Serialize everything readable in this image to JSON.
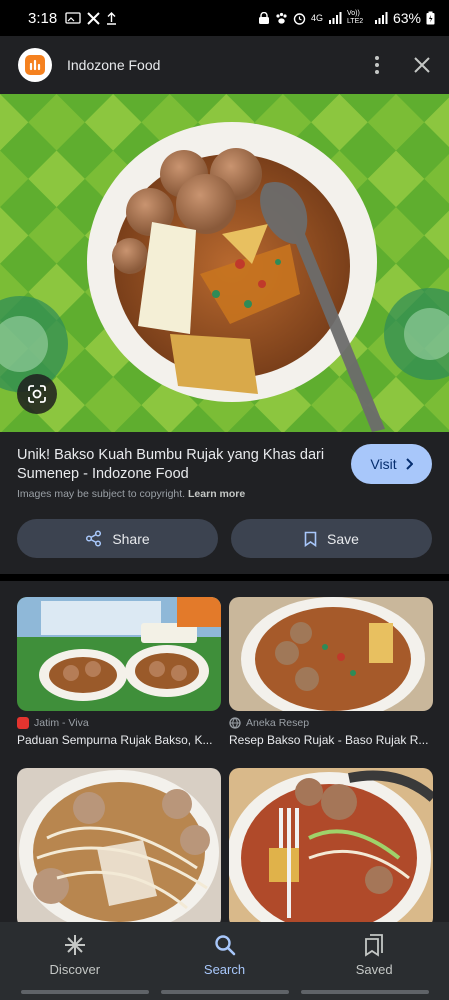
{
  "status_bar": {
    "time": "3:18",
    "network_label": "4G",
    "volte_label": "Vo)) LTE2",
    "battery": "63%"
  },
  "source": {
    "name": "Indozone Food",
    "logo_color": "#f5811f"
  },
  "result": {
    "title": "Unik! Bakso Kuah Bumbu Rujak yang Khas dari Sumenep - Indozone Food",
    "visit_label": "Visit",
    "copyright_text": "Images may be subject to copyright.",
    "learn_more": "Learn more",
    "share_label": "Share",
    "save_label": "Save"
  },
  "related": [
    {
      "source": "Jatim - Viva",
      "title": "Paduan Sempurna Rujak Bakso, K...",
      "favicon_color": "#e3342f"
    },
    {
      "source": "Aneka Resep",
      "title": "Resep Bakso Rujak - Baso Rujak R...",
      "favicon_color": "#9aa0a6"
    },
    {
      "source": "",
      "title": "",
      "favicon_color": "#f5811f"
    },
    {
      "source": "",
      "title": "",
      "favicon_color": "#9aa0a6"
    }
  ],
  "nav": {
    "discover": "Discover",
    "search": "Search",
    "saved": "Saved"
  },
  "colors": {
    "accent": "#a8c7fa",
    "background": "#202124"
  }
}
